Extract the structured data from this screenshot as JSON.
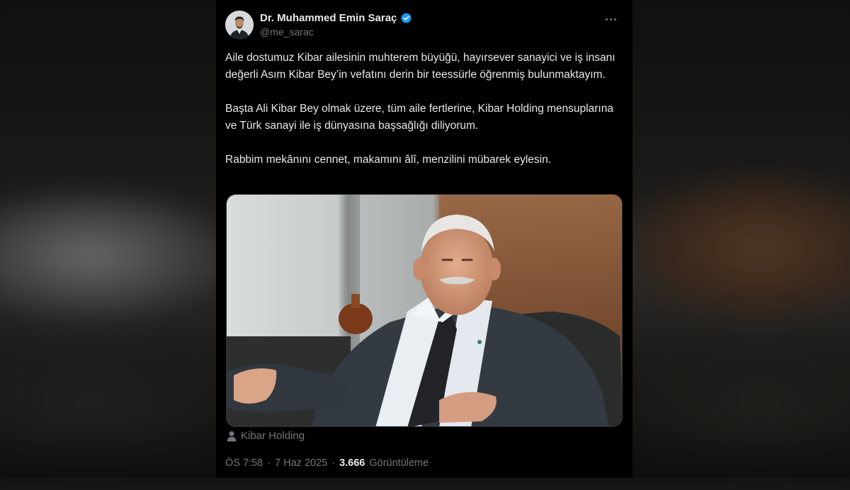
{
  "author": {
    "name": "Dr. Muhammed Emin Saraç",
    "handle": "@me_sarac",
    "verified": true
  },
  "tweet": {
    "paragraphs": [
      "Aile dostumuz Kibar ailesinin muhterem büyüğü, hayırsever sanayici ve iş insanı değerli Asım Kibar Bey’in vefatını derin bir teessürle öğrenmiş bulunmaktayım.",
      "Başta Ali Kibar Bey olmak üzere, tüm aile fertlerine, Kibar Holding mensuplarına ve Türk sanayi ile iş dünyasına başsağlığı diliyorum.",
      "Rabbim mekânını cennet, makamını âlî, menzilini mübarek eylesin."
    ],
    "media_tag": "Kibar Holding"
  },
  "meta": {
    "time": "ÖS 7:58",
    "separator": "·",
    "date": "7 Haz 2025",
    "views_count": "3.666",
    "views_label": "Görüntüleme"
  },
  "colors": {
    "background": "#000000",
    "text": "#e7e9ea",
    "muted": "#71767b",
    "verified": "#1d9bf0"
  }
}
